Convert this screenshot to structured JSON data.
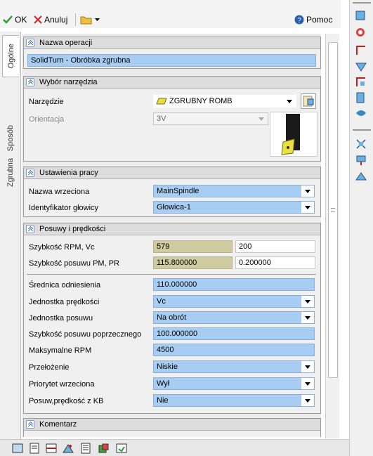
{
  "toolbar": {
    "ok": "OK",
    "cancel": "Anuluj",
    "help": "Pomoc"
  },
  "tabs": [
    "Ogólne",
    "Sposób",
    "Zgrubna"
  ],
  "sections": {
    "operation_name": {
      "title": "Nazwa operacji",
      "value": "SolidTurn - Obróbka zgrubna"
    },
    "tool": {
      "title": "Wybór narzędzia",
      "tool_label": "Narzędzie",
      "tool_value": "ZGRUBNY ROMB",
      "orientation_label": "Orientacja",
      "orientation_value": "3V"
    },
    "work": {
      "title": "Ustawienia pracy",
      "spindle_label": "Nazwa wrzeciona",
      "spindle_value": "MainSpindle",
      "head_label": "Identyfikator głowicy",
      "head_value": "Głowica-1"
    },
    "feeds": {
      "title": "Posuwy i prędkości",
      "rpm_label": "Szybkość RPM, Vc",
      "rpm_value": "579",
      "rpm_value2": "200",
      "feed_label": "Szybkość posuwu PM, PR",
      "feed_value": "115.800000",
      "feed_value2": "0.200000",
      "diam_label": "Średnica odniesienia",
      "diam_value": "110.000000",
      "speed_unit_label": "Jednostka prędkości",
      "speed_unit_value": "Vc",
      "feed_unit_label": "Jednostka posuwu",
      "feed_unit_value": "Na obrót",
      "cross_feed_label": "Szybkość posuwu poprzecznego",
      "cross_feed_value": "100.000000",
      "max_rpm_label": "Maksymalne RPM",
      "max_rpm_value": "4500",
      "gear_label": "Przełożenie",
      "gear_value": "Niskie",
      "priority_label": "Priorytet wrzeciona",
      "priority_value": "Wył",
      "kb_label": "Posuw,prędkość z KB",
      "kb_value": "Nie"
    },
    "comment": {
      "title": "Komentarz"
    }
  }
}
